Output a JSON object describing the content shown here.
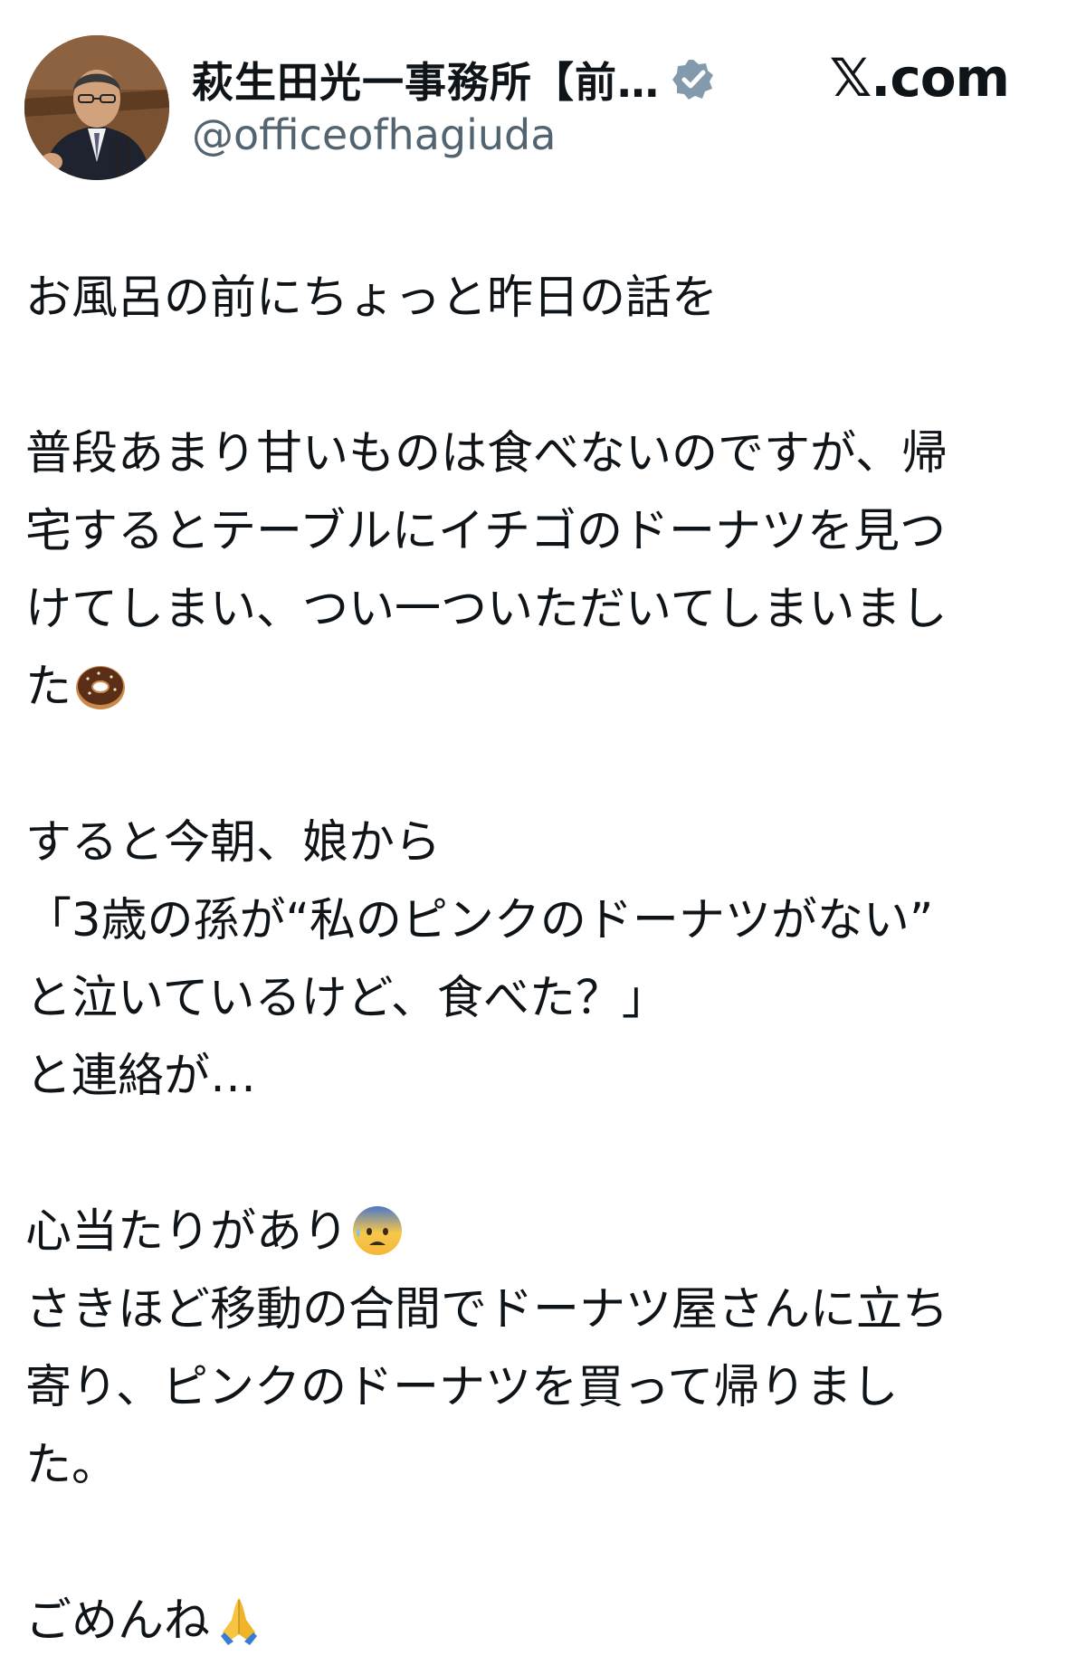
{
  "header": {
    "display_name": "萩生田光一事務所【前…",
    "handle": "@officeofhagiuda",
    "site_label": "𝕏.com",
    "icons": {
      "avatar": "profile-photo",
      "verified": "verified-badge-icon"
    }
  },
  "tweet": {
    "lines": [
      "お風呂の前にちょっと昨日の話を",
      "",
      "普段あまり甘いものは食べないのですが、帰",
      "宅するとテーブルにイチゴのドーナツを見つ",
      "けてしまい、つい一ついただいてしまいまし",
      "た",
      "",
      "すると今朝、娘から",
      "「3歳の孫が“私のピンクのドーナツがない”",
      "と泣いているけど、食べた？」",
      "と連絡が…",
      "",
      "心当たりがあり",
      "さきほど移動の合間でドーナツ屋さんに立ち",
      "寄り、ピンクのドーナツを買って帰りまし",
      "た。",
      "",
      "ごめんね"
    ],
    "emojis": {
      "donut": "doughnut-emoji",
      "anxious": "anxious-face-with-sweat-emoji",
      "pray": "folded-hands-emoji"
    }
  },
  "colors": {
    "text": "#0f1419",
    "secondary_text": "#536471",
    "verified_badge": "#829aab"
  }
}
